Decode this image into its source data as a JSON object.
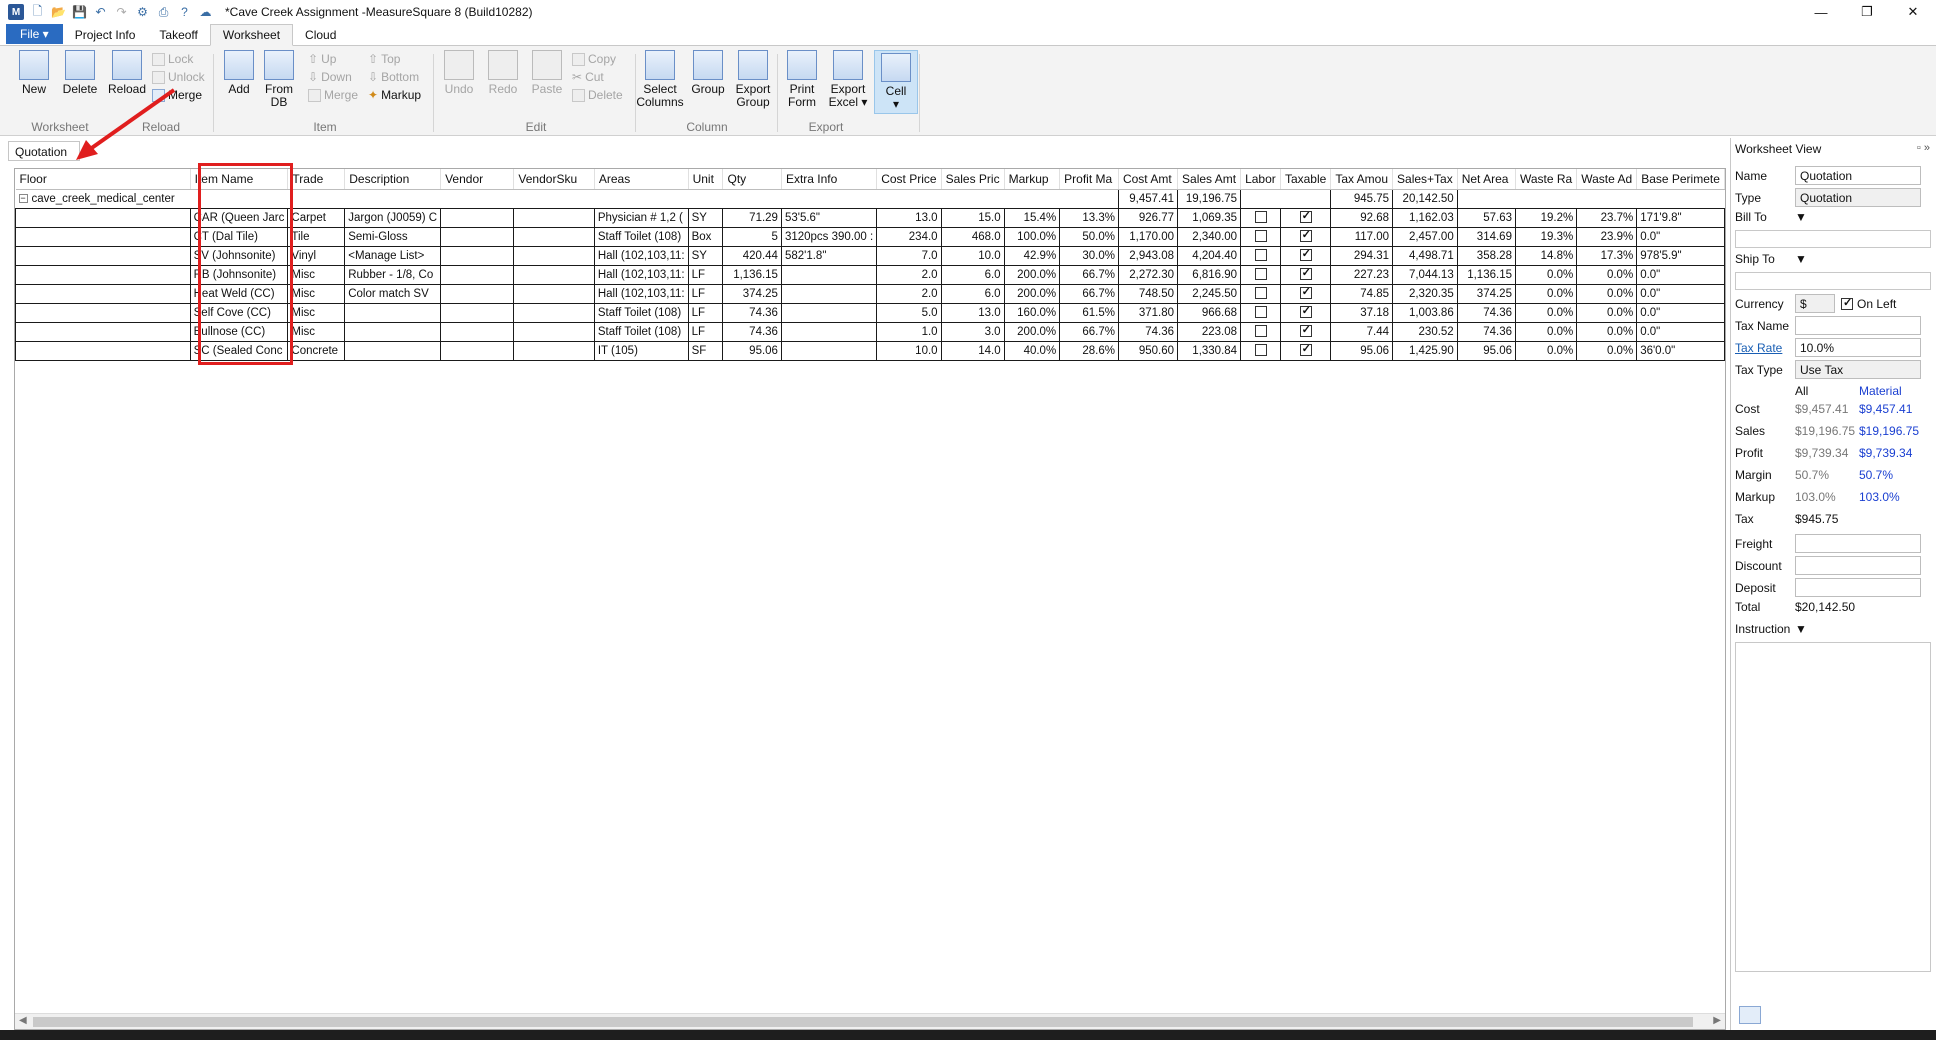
{
  "window": {
    "title": "*Cave Creek Assignment -MeasureSquare 8 (Build10282)",
    "app_icon": "M"
  },
  "tabs": [
    {
      "label": "File ▾"
    },
    {
      "label": "Project Info"
    },
    {
      "label": "Takeoff"
    },
    {
      "label": "Worksheet"
    },
    {
      "label": "Cloud"
    }
  ],
  "ribbon": {
    "worksheet": {
      "label": "Worksheet",
      "new": "New",
      "delete": "Delete"
    },
    "reload": {
      "label": "Reload",
      "reload": "Reload",
      "lock": "Lock",
      "unlock": "Unlock",
      "merge": "Merge"
    },
    "item": {
      "label": "Item",
      "add": "Add",
      "from_db_1": "From",
      "from_db_2": "DB",
      "up": "Up",
      "down": "Down",
      "merge": "Merge",
      "top": "Top",
      "bottom": "Bottom",
      "markup": "Markup"
    },
    "edit": {
      "label": "Edit",
      "undo": "Undo",
      "redo": "Redo",
      "paste": "Paste",
      "copy": "Copy",
      "cut": "Cut",
      "delete": "Delete"
    },
    "column": {
      "label": "Column",
      "select_1": "Select",
      "select_2": "Columns",
      "group": "Group",
      "export_group_1": "Export",
      "export_group_2": "Group"
    },
    "export": {
      "label": "Export",
      "print_1": "Print",
      "print_2": "Form",
      "excel_1": "Export",
      "excel_2": "Excel ▾"
    },
    "cell": {
      "label": "Cell",
      "arrow": "▾"
    }
  },
  "quotation_label": "Quotation",
  "columns": [
    "Floor",
    "Item Name",
    "Trade",
    "Description",
    "Vendor",
    "VendorSku",
    "Areas",
    "Unit",
    "Qty",
    "Extra Info",
    "Cost Price",
    "Sales Pric",
    "Markup",
    "Profit Ma",
    "Cost Amt",
    "Sales Amt",
    "Labor",
    "Taxable",
    "Tax Amou",
    "Sales+Tax",
    "Net Area",
    "Waste Ra",
    "Waste Ad",
    "Base Perimete"
  ],
  "group_row": {
    "floor": "cave_creek_medical_center",
    "cost_amt": "9,457.41",
    "sales_amt": "19,196.75",
    "tax_amt": "945.75",
    "sales_tax": "20,142.50"
  },
  "rows": [
    {
      "item": "CAR (Queen Jarc",
      "trade": "Carpet",
      "desc": "Jargon (J0059) C",
      "vendor": "",
      "sku": "",
      "areas": "Physician # 1,2 (",
      "unit": "SY",
      "qty": "71.29",
      "extra": "53'5.6\"",
      "cost_price": "13.0",
      "sales_price": "15.0",
      "markup": "15.4%",
      "profit": "13.3%",
      "cost_amt": "926.77",
      "sales_amt": "1,069.35",
      "labor": false,
      "taxable": true,
      "tax": "92.68",
      "sales_tax": "1,162.03",
      "net": "57.63",
      "waste_rate": "19.2%",
      "waste_add": "23.7%",
      "base": "171'9.8\""
    },
    {
      "item": "CT (Dal Tile)",
      "trade": "Tile",
      "desc": "Semi-Gloss",
      "vendor": "",
      "sku": "",
      "areas": "Staff Toilet (108)",
      "unit": "Box",
      "qty": "5",
      "extra": "3120pcs 390.00 :",
      "cost_price": "234.0",
      "sales_price": "468.0",
      "markup": "100.0%",
      "profit": "50.0%",
      "cost_amt": "1,170.00",
      "sales_amt": "2,340.00",
      "labor": false,
      "taxable": true,
      "tax": "117.00",
      "sales_tax": "2,457.00",
      "net": "314.69",
      "waste_rate": "19.3%",
      "waste_add": "23.9%",
      "base": "0.0\""
    },
    {
      "item": "SV (Johnsonite)",
      "trade": "Vinyl",
      "desc": "<Manage List>",
      "vendor": "",
      "sku": "",
      "areas": "Hall (102,103,11:",
      "unit": "SY",
      "qty": "420.44",
      "extra": "582'1.8\"",
      "cost_price": "7.0",
      "sales_price": "10.0",
      "markup": "42.9%",
      "profit": "30.0%",
      "cost_amt": "2,943.08",
      "sales_amt": "4,204.40",
      "labor": false,
      "taxable": true,
      "tax": "294.31",
      "sales_tax": "4,498.71",
      "net": "358.28",
      "waste_rate": "14.8%",
      "waste_add": "17.3%",
      "base": "978'5.9\""
    },
    {
      "item": "RB (Johnsonite)",
      "trade": "Misc",
      "desc": "Rubber - 1/8, Co",
      "vendor": "",
      "sku": "",
      "areas": "Hall (102,103,11:",
      "unit": "LF",
      "qty": "1,136.15",
      "extra": "",
      "cost_price": "2.0",
      "sales_price": "6.0",
      "markup": "200.0%",
      "profit": "66.7%",
      "cost_amt": "2,272.30",
      "sales_amt": "6,816.90",
      "labor": false,
      "taxable": true,
      "tax": "227.23",
      "sales_tax": "7,044.13",
      "net": "1,136.15",
      "waste_rate": "0.0%",
      "waste_add": "0.0%",
      "base": "0.0\""
    },
    {
      "item": "Heat Weld (CC)",
      "trade": "Misc",
      "desc": "Color match SV",
      "vendor": "",
      "sku": "",
      "areas": "Hall (102,103,11:",
      "unit": "LF",
      "qty": "374.25",
      "extra": "",
      "cost_price": "2.0",
      "sales_price": "6.0",
      "markup": "200.0%",
      "profit": "66.7%",
      "cost_amt": "748.50",
      "sales_amt": "2,245.50",
      "labor": false,
      "taxable": true,
      "tax": "74.85",
      "sales_tax": "2,320.35",
      "net": "374.25",
      "waste_rate": "0.0%",
      "waste_add": "0.0%",
      "base": "0.0\""
    },
    {
      "item": "Self Cove (CC)",
      "trade": "Misc",
      "desc": "",
      "vendor": "",
      "sku": "",
      "areas": "Staff Toilet (108)",
      "unit": "LF",
      "qty": "74.36",
      "extra": "",
      "cost_price": "5.0",
      "sales_price": "13.0",
      "markup": "160.0%",
      "profit": "61.5%",
      "cost_amt": "371.80",
      "sales_amt": "966.68",
      "labor": false,
      "taxable": true,
      "tax": "37.18",
      "sales_tax": "1,003.86",
      "net": "74.36",
      "waste_rate": "0.0%",
      "waste_add": "0.0%",
      "base": "0.0\""
    },
    {
      "item": "Bullnose (CC)",
      "trade": "Misc",
      "desc": "",
      "vendor": "",
      "sku": "",
      "areas": "Staff Toilet (108)",
      "unit": "LF",
      "qty": "74.36",
      "extra": "",
      "cost_price": "1.0",
      "sales_price": "3.0",
      "markup": "200.0%",
      "profit": "66.7%",
      "cost_amt": "74.36",
      "sales_amt": "223.08",
      "labor": false,
      "taxable": true,
      "tax": "7.44",
      "sales_tax": "230.52",
      "net": "74.36",
      "waste_rate": "0.0%",
      "waste_add": "0.0%",
      "base": "0.0\""
    },
    {
      "item": "SC (Sealed Conc",
      "trade": "Concrete",
      "desc": "",
      "vendor": "",
      "sku": "",
      "areas": "IT (105)",
      "unit": "SF",
      "qty": "95.06",
      "extra": "",
      "cost_price": "10.0",
      "sales_price": "14.0",
      "markup": "40.0%",
      "profit": "28.6%",
      "cost_amt": "950.60",
      "sales_amt": "1,330.84",
      "labor": false,
      "taxable": true,
      "tax": "95.06",
      "sales_tax": "1,425.90",
      "net": "95.06",
      "waste_rate": "0.0%",
      "waste_add": "0.0%",
      "base": "36'0.0\""
    }
  ],
  "panel": {
    "title": "Worksheet View",
    "name_label": "Name",
    "name_value": "Quotation",
    "type_label": "Type",
    "type_value": "Quotation",
    "bill_to": "Bill To",
    "ship_to": "Ship To",
    "currency_label": "Currency",
    "currency_value": "$",
    "on_left": "On Left",
    "tax_name": "Tax Name",
    "tax_rate_label": "Tax Rate",
    "tax_rate_value": "10.0%",
    "tax_type_label": "Tax Type",
    "tax_type_value": "Use Tax",
    "col_all": "All",
    "col_material": "Material",
    "cost_label": "Cost",
    "cost_all": "$9,457.41",
    "cost_mat": "$9,457.41",
    "sales_label": "Sales",
    "sales_all": "$19,196.75",
    "sales_mat": "$19,196.75",
    "profit_label": "Profit",
    "profit_all": "$9,739.34",
    "profit_mat": "$9,739.34",
    "margin_label": "Margin",
    "margin_all": "50.7%",
    "margin_mat": "50.7%",
    "markup_label": "Markup",
    "markup_all": "103.0%",
    "markup_mat": "103.0%",
    "tax_label": "Tax",
    "tax_value": "$945.75",
    "freight_label": "Freight",
    "discount_label": "Discount",
    "deposit_label": "Deposit",
    "total_label": "Total",
    "total_value": "$20,142.50",
    "instruction_label": "Instruction"
  }
}
